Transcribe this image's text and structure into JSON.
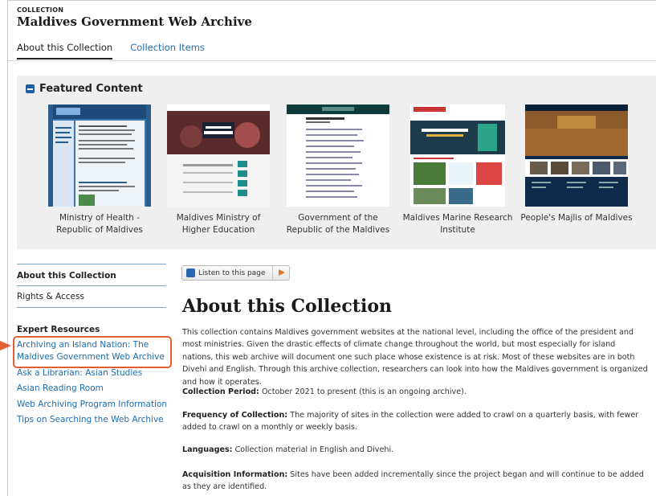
{
  "header": {
    "eyebrow": "COLLECTION",
    "title": "Maldives Government Web Archive",
    "tabs": [
      {
        "label": "About this Collection"
      },
      {
        "label": "Collection Items"
      }
    ]
  },
  "featured": {
    "heading": "Featured Content",
    "items": [
      {
        "label": "Ministry of Health - Republic of Maldives"
      },
      {
        "label": "Maldives Ministry of Higher Education"
      },
      {
        "label": "Government of the Republic of the Maldives"
      },
      {
        "label": "Maldives Marine Research Institute"
      },
      {
        "label": "People's Majlis of Maldives"
      }
    ]
  },
  "sidebar": {
    "items": [
      "About this Collection",
      "Rights & Access"
    ],
    "resources_heading": "Expert Resources",
    "resources": [
      "Archiving an Island Nation: The Maldives Government Web Archive",
      "Ask a Librarian: Asian Studies",
      "Asian Reading Room",
      "Web Archiving Program Information",
      "Tips on Searching the Web Archive"
    ]
  },
  "listen": {
    "label": "Listen to this page"
  },
  "main": {
    "title": "About this Collection",
    "intro": "This collection contains Maldives government websites at the national level, including the office of the president and most ministries. Given the drastic effects of climate change throughout the world, but most especially for island nations, this web archive will document one such place whose existence is at risk. Most of these websites are in both Divehi and English. Through this archive collection, researchers can look into how the Maldives government is organized and how it operates.",
    "period_label": "Collection Period:",
    "period_text": "October 2021 to present (this is an ongoing archive).",
    "frequency_label": "Frequency of Collection:",
    "frequency_text": "The majority of sites in the collection were added to crawl on a quarterly basis, with fewer added to crawl on a monthly or weekly basis.",
    "languages_label": "Languages:",
    "languages_text": "Collection material in English and Divehi.",
    "acquisition_label": "Acquisition Information:",
    "acquisition_text": "Sites have been added incrementally since the project began and will continue to be added as they are identified."
  }
}
